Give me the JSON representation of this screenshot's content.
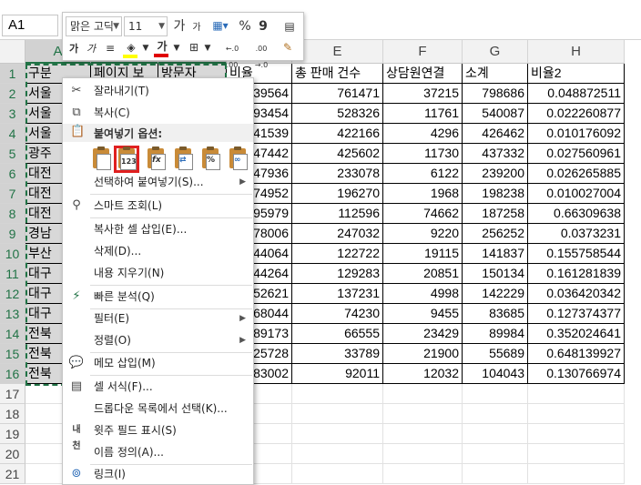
{
  "namebox": {
    "value": "A1"
  },
  "columns": [
    "A",
    "B",
    "C",
    "D",
    "E",
    "F",
    "G",
    "H"
  ],
  "rows": [
    "1",
    "2",
    "3",
    "4",
    "5",
    "6",
    "7",
    "8",
    "9",
    "10",
    "11",
    "12",
    "13",
    "14",
    "15",
    "16",
    "17",
    "18",
    "19",
    "20",
    "21"
  ],
  "header_row": {
    "a": "구분",
    "b": "페이지 보",
    "c": "방문자",
    "d": "비율",
    "e": "총 판매 건수",
    "f": "상담원연결",
    "g": "소계",
    "h": "비율2"
  },
  "data_rows": [
    {
      "a": "서울",
      "d": "39564",
      "e": "761471",
      "f": "37215",
      "g": "798686",
      "h": "0.048872511"
    },
    {
      "a": "서울",
      "d": "93454",
      "e": "528326",
      "f": "11761",
      "g": "540087",
      "h": "0.022260877"
    },
    {
      "a": "서울",
      "d": "41539",
      "e": "422166",
      "f": "4296",
      "g": "426462",
      "h": "0.010176092"
    },
    {
      "a": "광주",
      "d": "47442",
      "e": "425602",
      "f": "11730",
      "g": "437332",
      "h": "0.027560961"
    },
    {
      "a": "대전",
      "d": "47936",
      "e": "233078",
      "f": "6122",
      "g": "239200",
      "h": "0.026265885"
    },
    {
      "a": "대전",
      "d": "74952",
      "e": "196270",
      "f": "1968",
      "g": "198238",
      "h": "0.010027004"
    },
    {
      "a": "대전",
      "d": "95979",
      "e": "112596",
      "f": "74662",
      "g": "187258",
      "h": "0.66309638"
    },
    {
      "a": "경남",
      "d": "78006",
      "e": "247032",
      "f": "9220",
      "g": "256252",
      "h": "0.0373231"
    },
    {
      "a": "부산",
      "d": "44064",
      "e": "122722",
      "f": "19115",
      "g": "141837",
      "h": "0.155758544"
    },
    {
      "a": "대구",
      "d": "44264",
      "e": "129283",
      "f": "20851",
      "g": "150134",
      "h": "0.161281839"
    },
    {
      "a": "대구",
      "d": "52621",
      "e": "137231",
      "f": "4998",
      "g": "142229",
      "h": "0.036420342"
    },
    {
      "a": "대구",
      "d": "68044",
      "e": "74230",
      "f": "9455",
      "g": "83685",
      "h": "0.127374377"
    },
    {
      "a": "전북",
      "d": "89173",
      "e": "66555",
      "f": "23429",
      "g": "89984",
      "h": "0.352024641"
    },
    {
      "a": "전북",
      "d": "25728",
      "e": "33789",
      "f": "21900",
      "g": "55689",
      "h": "0.648139927"
    },
    {
      "a": "전북",
      "d": "83002",
      "e": "92011",
      "f": "12032",
      "g": "104043",
      "h": "0.130766974"
    }
  ],
  "mini_toolbar": {
    "font_name": "맑은 고딕",
    "font_size": "11",
    "grow_font": "가",
    "shrink_font": "가",
    "percent": "%",
    "comma": "9",
    "bold": "가",
    "italic": "가",
    "align": "≡",
    "font_color_glyph": "가",
    "inc_decimal": "←.0 .00",
    "dec_decimal": ".00 →.0",
    "font_color": "#e00000",
    "fill_color": "#ffff00"
  },
  "context_menu": {
    "cut": "잘라내기(T)",
    "copy": "복사(C)",
    "paste_options_header": "붙여넣기 옵션:",
    "paste_special": "선택하여 붙여넣기(S)...",
    "smart_lookup": "스마트 조회(L)",
    "insert_copied": "복사한 셀 삽입(E)...",
    "delete": "삭제(D)...",
    "clear_contents": "내용 지우기(N)",
    "quick_analysis": "빠른 분석(Q)",
    "filter": "필터(E)",
    "sort": "정렬(O)",
    "insert_comment": "메모 삽입(M)",
    "format_cells": "셀 서식(F)...",
    "pick_from_list": "드롭다운 목록에서 선택(K)...",
    "phonetic": "윗주 필드 표시(S)",
    "define_name": "이름 정의(A)...",
    "link": "링크(I)",
    "paste_icon_values_label": "123",
    "paste_icon_formula_label": "fx",
    "paste_icon_percent_label": "%"
  },
  "colors": {
    "accent": "#217346",
    "highlight_border": "#e02020"
  }
}
